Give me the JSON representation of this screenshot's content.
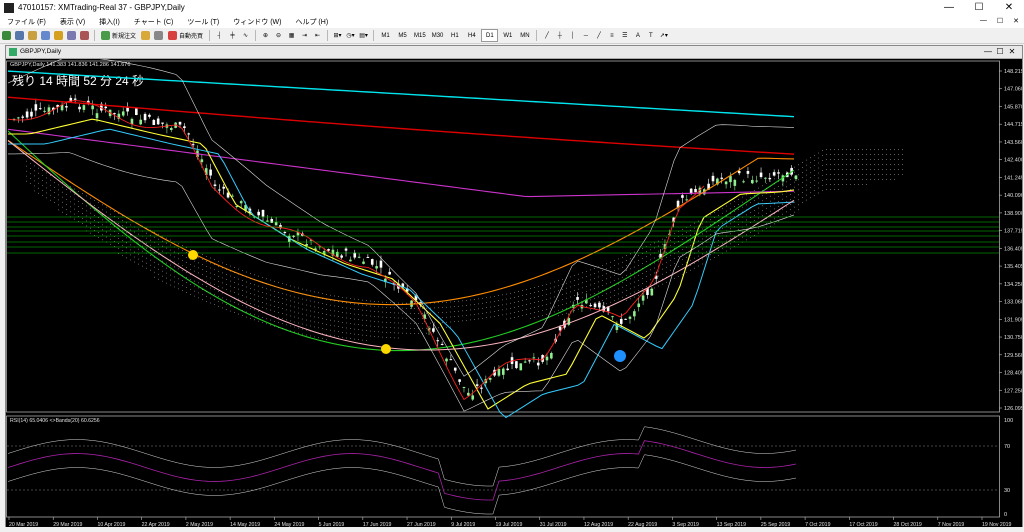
{
  "window": {
    "title": "47010157: XMTrading-Real 37 - GBPJPY,Daily",
    "min": "—",
    "max": "☐",
    "close": "✕"
  },
  "menu": [
    "ファイル (F)",
    "表示 (V)",
    "挿入(I)",
    "チャート (C)",
    "ツール (T)",
    "ウィンドウ (W)",
    "ヘルプ (H)"
  ],
  "toolbar": {
    "new_order": "新規注文",
    "auto_trade": "自動売買",
    "timeframes": [
      "M1",
      "M5",
      "M15",
      "M30",
      "H1",
      "H4",
      "D1",
      "W1",
      "MN"
    ]
  },
  "chart": {
    "tab_title": "GBPJPY,Daily",
    "header": "GBPJPY,Daily  141.383 141.836 141.286 141.676",
    "countdown": "残り 14 時間 52 分 24 秒",
    "rsi_label": "RSI(14) 65.0406  <>Bands(20) 60.6256",
    "price_labels": [
      "148.215",
      "147.060",
      "145.870",
      "144.715",
      "143.560",
      "142.400",
      "141.245",
      "140.090",
      "138.900",
      "137.715",
      "136.405",
      "135.405",
      "134.250",
      "133.060",
      "131.905",
      "130.750",
      "129.560",
      "128.405",
      "127.250",
      "126.095"
    ],
    "rsi_levels": [
      "100",
      "70",
      "30",
      "0"
    ],
    "dates": [
      "20 Mar 2019",
      "29 Mar 2019",
      "10 Apr 2019",
      "22 Apr 2019",
      "2 May 2019",
      "14 May 2019",
      "24 May 2019",
      "5 Jun 2019",
      "17 Jun 2019",
      "27 Jun 2019",
      "9 Jul 2019",
      "19 Jul 2019",
      "31 Jul 2019",
      "12 Aug 2019",
      "22 Aug 2019",
      "3 Sep 2019",
      "13 Sep 2019",
      "25 Sep 2019",
      "7 Oct 2019",
      "17 Oct 2019",
      "28 Oct 2019",
      "7 Nov 2019",
      "19 Nov 2019"
    ],
    "colors": {
      "bull": "#90ee90",
      "bear": "#ffffff",
      "ma_cyan": "#00e5ee",
      "ma_red": "#dd0000",
      "ma_magenta": "#cc33cc",
      "ma_pink": "#ffb6c1",
      "ma_orange": "#ff8c00",
      "ma_green": "#22cc22",
      "ma_yellow": "#ffff33",
      "ma_sky": "#33ccff",
      "ma_red2": "#ff2020",
      "hline": "#00cc00",
      "rsi": "#aa22aa"
    }
  }
}
